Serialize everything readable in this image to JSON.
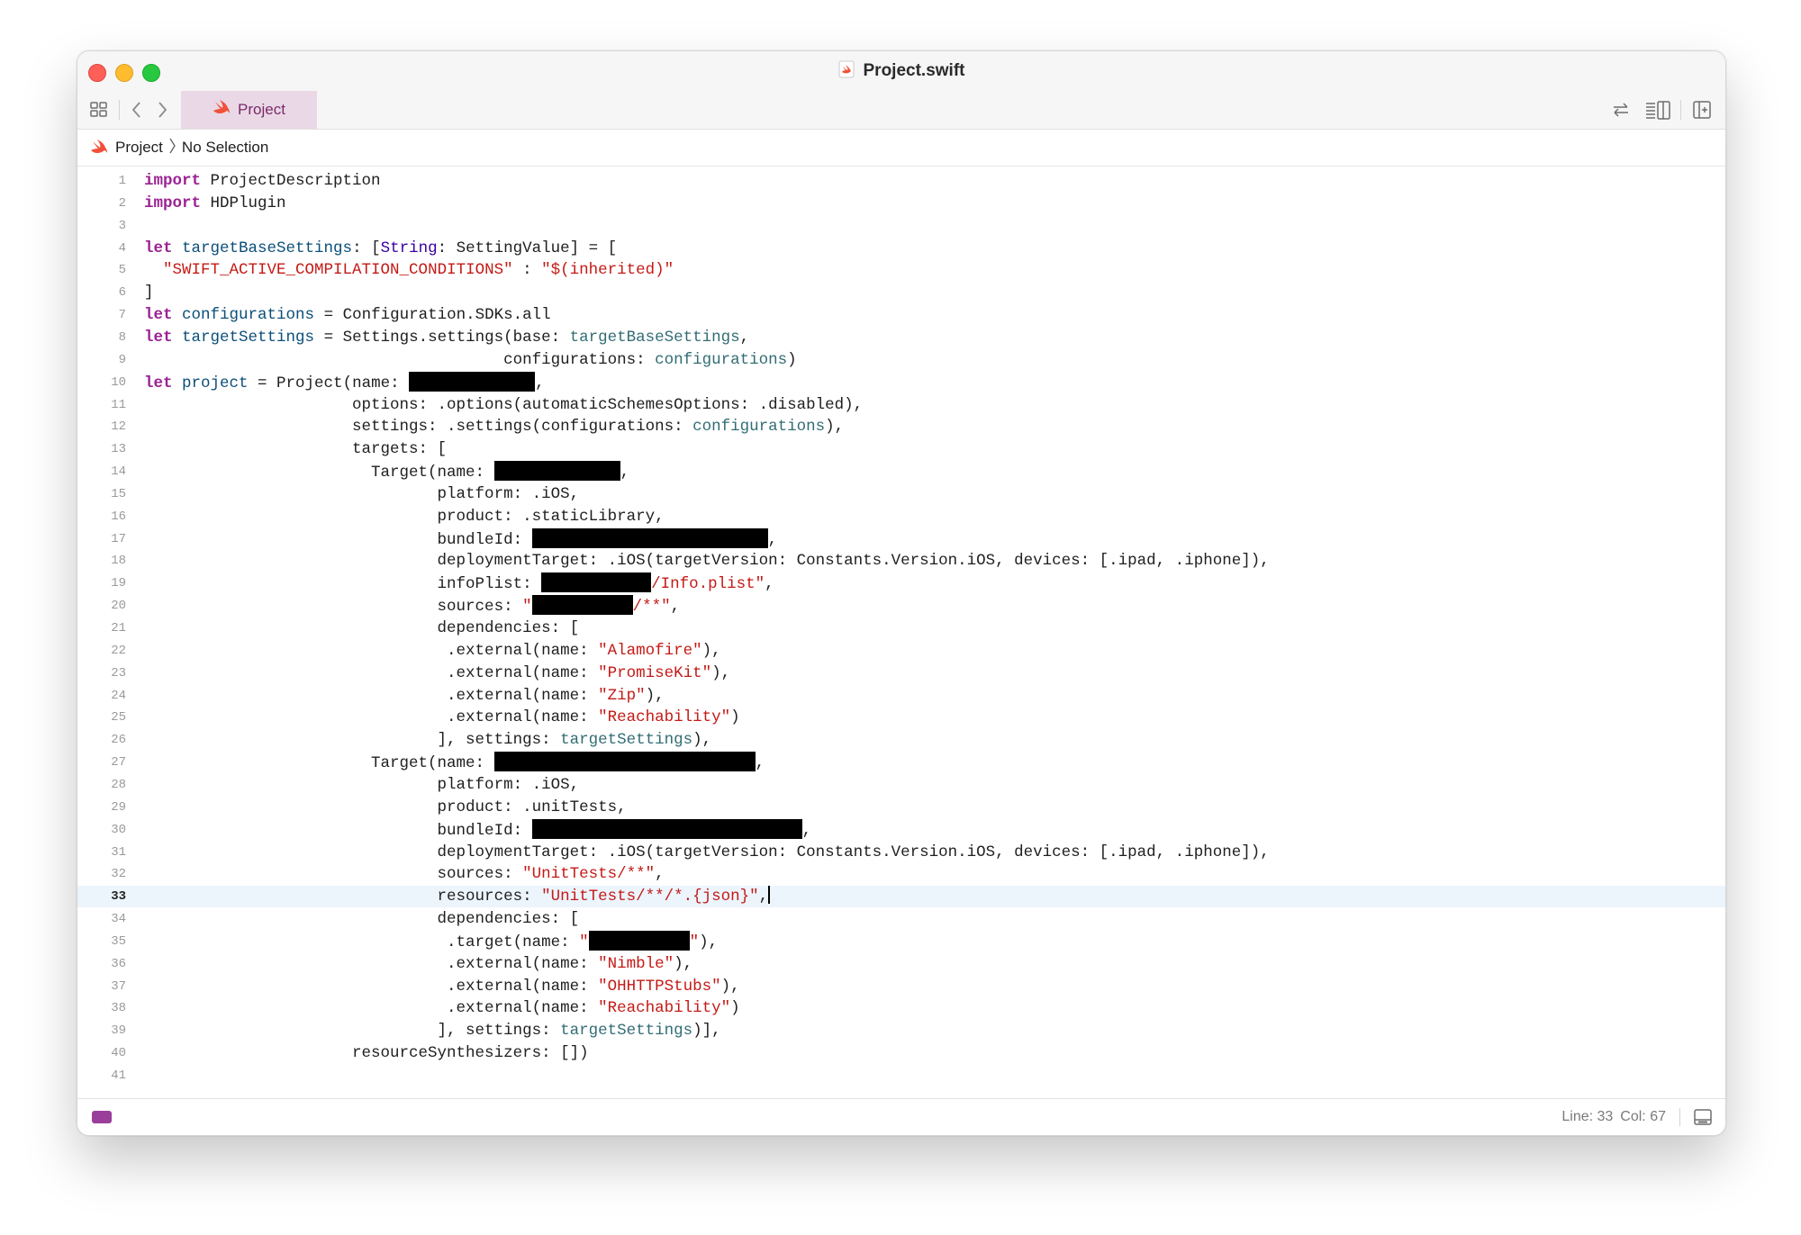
{
  "window": {
    "title": "Project.swift",
    "file_icon": "swift-file-icon"
  },
  "tabbar": {
    "tab_label": "Project",
    "tab_color": "#ead8e6",
    "icons": [
      "grid-icon",
      "back-icon",
      "forward-icon",
      "swap-icon",
      "inspector-icon",
      "add-editor-icon"
    ]
  },
  "breadcrumb": {
    "project": "Project",
    "selection": "No Selection"
  },
  "code_lines": [
    {
      "n": "1",
      "t": "import ProjectDescription"
    },
    {
      "n": "2",
      "t": "import HDPlugin"
    },
    {
      "n": "3",
      "t": ""
    },
    {
      "n": "4",
      "t": "let targetBaseSettings: [String: SettingValue] = ["
    },
    {
      "n": "5",
      "t": "  \"SWIFT_ACTIVE_COMPILATION_CONDITIONS\" : \"$(inherited)\""
    },
    {
      "n": "6",
      "t": "]"
    },
    {
      "n": "7",
      "t": "let configurations = Configuration.SDKs.all"
    },
    {
      "n": "8",
      "t": "let targetSettings = Settings.settings(base: targetBaseSettings,"
    },
    {
      "n": "9",
      "t": "                                      configurations: configurations)"
    },
    {
      "n": "10",
      "t": "let project = Project(name: [redacted],"
    },
    {
      "n": "11",
      "t": "                      options: .options(automaticSchemesOptions: .disabled),"
    },
    {
      "n": "12",
      "t": "                      settings: .settings(configurations: configurations),"
    },
    {
      "n": "13",
      "t": "                      targets: ["
    },
    {
      "n": "14",
      "t": "                        Target(name: [redacted],"
    },
    {
      "n": "15",
      "t": "                               platform: .iOS,"
    },
    {
      "n": "16",
      "t": "                               product: .staticLibrary,"
    },
    {
      "n": "17",
      "t": "                               bundleId: [redacted],"
    },
    {
      "n": "18",
      "t": "                               deploymentTarget: .iOS(targetVersion: Constants.Version.iOS, devices: [.ipad, .iphone]),"
    },
    {
      "n": "19",
      "t": "                               infoPlist: [redacted]/Info.plist\","
    },
    {
      "n": "20",
      "t": "                               sources: \"[redacted]/**\","
    },
    {
      "n": "21",
      "t": "                               dependencies: ["
    },
    {
      "n": "22",
      "t": "                                .external(name: \"Alamofire\"),"
    },
    {
      "n": "23",
      "t": "                                .external(name: \"PromiseKit\"),"
    },
    {
      "n": "24",
      "t": "                                .external(name: \"Zip\"),"
    },
    {
      "n": "25",
      "t": "                                .external(name: \"Reachability\")"
    },
    {
      "n": "26",
      "t": "                               ], settings: targetSettings),"
    },
    {
      "n": "27",
      "t": "                        Target(name: [redacted],"
    },
    {
      "n": "28",
      "t": "                               platform: .iOS,"
    },
    {
      "n": "29",
      "t": "                               product: .unitTests,"
    },
    {
      "n": "30",
      "t": "                               bundleId: [redacted],"
    },
    {
      "n": "31",
      "t": "                               deploymentTarget: .iOS(targetVersion: Constants.Version.iOS, devices: [.ipad, .iphone]),"
    },
    {
      "n": "32",
      "t": "                               sources: \"UnitTests/**\","
    },
    {
      "n": "33",
      "t": "                               resources: \"UnitTests/**/*.{json}\","
    },
    {
      "n": "34",
      "t": "                               dependencies: ["
    },
    {
      "n": "35",
      "t": "                                .target(name: \"[redacted]\"),"
    },
    {
      "n": "36",
      "t": "                                .external(name: \"Nimble\"),"
    },
    {
      "n": "37",
      "t": "                                .external(name: \"OHHTTPStubs\"),"
    },
    {
      "n": "38",
      "t": "                                .external(name: \"Reachability\")"
    },
    {
      "n": "39",
      "t": "                               ], settings: targetSettings)],"
    },
    {
      "n": "40",
      "t": "                      resourceSynthesizers: [])"
    },
    {
      "n": "41",
      "t": ""
    }
  ],
  "current_line": 33,
  "statusbar": {
    "line": "Line: 33",
    "col": "Col: 67",
    "tag_color": "#9a3e9c"
  },
  "syntax_colors": {
    "keyword": "#9b2393",
    "declaration": "#0b4f79",
    "string": "#c41a16",
    "type": "#3900a0",
    "reference": "#326d74"
  }
}
